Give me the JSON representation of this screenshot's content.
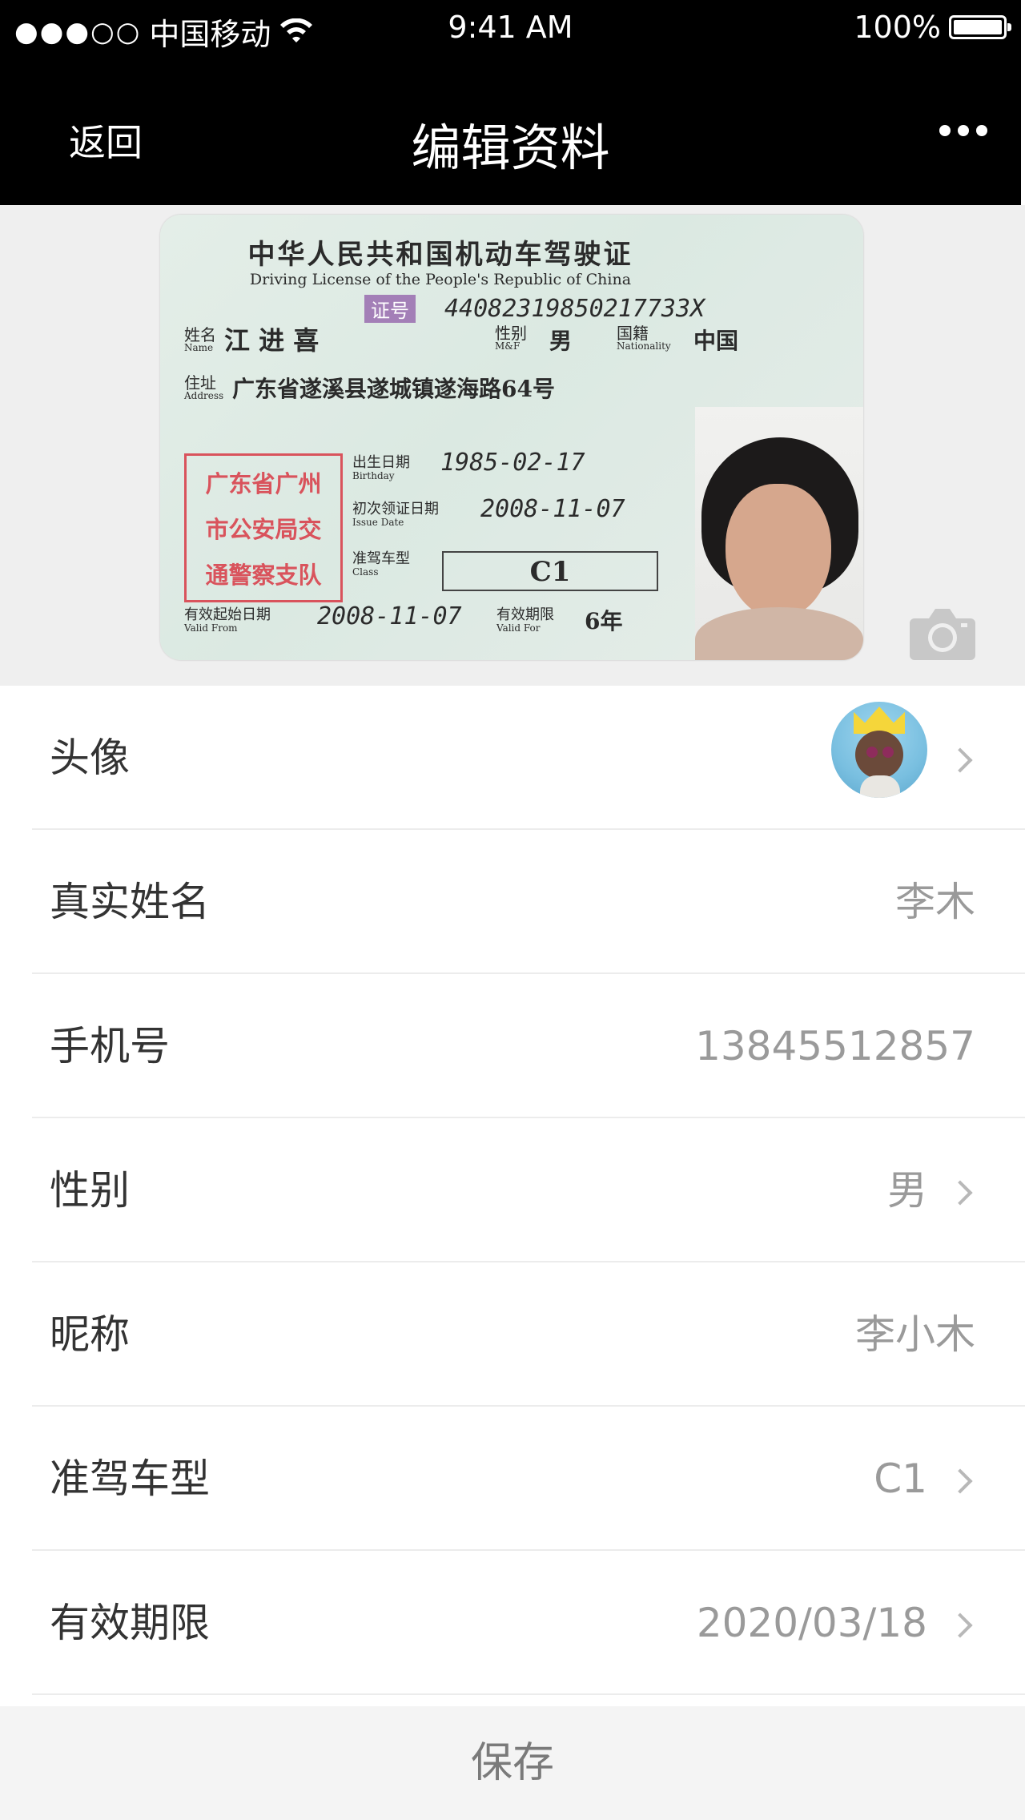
{
  "status_bar": {
    "signal": "●●●○○",
    "carrier": "中国移动",
    "time": "9:41 AM",
    "battery_text": "100%",
    "battery_level": 1.0
  },
  "nav": {
    "back_label": "返回",
    "title": "编辑资料",
    "more_icon": "more-icon"
  },
  "license": {
    "title": "中华人民共和国机动车驾驶证",
    "subtitle": "Driving License of the People's Republic of China",
    "cert_label": "证号",
    "cert_number": "44082319850217733X",
    "name_label": "姓名",
    "name_label_en": "Name",
    "name": "江 进 喜",
    "sex_label": "性别",
    "sex_label_en": "M&F",
    "sex": "男",
    "nationality_label": "国籍",
    "nationality_label_en": "Nationality",
    "nationality": "中国",
    "address_label": "住址",
    "address_label_en": "Address",
    "address": "广东省遂溪县遂城镇遂海路64号",
    "stamp_lines": [
      "广东省广州",
      "市公安局交",
      "通警察支队"
    ],
    "birthday_label": "出生日期",
    "birthday_label_en": "Birthday",
    "birthday": "1985-02-17",
    "issue_label": "初次领证日期",
    "issue_label_en": "Issue Date",
    "issue_date": "2008-11-07",
    "class_label": "准驾车型",
    "class_label_en": "Class",
    "class": "C1",
    "valid_from_label": "有效起始日期",
    "valid_from_label_en": "Valid From",
    "valid_from": "2008-11-07",
    "valid_for_label": "有效期限",
    "valid_for_label_en": "Valid For",
    "valid_for": "6年"
  },
  "rows": [
    {
      "label": "头像",
      "value": ""
    },
    {
      "label": "真实姓名",
      "value": "李木"
    },
    {
      "label": "手机号",
      "value": "13845512857"
    },
    {
      "label": "性别",
      "value": "男"
    },
    {
      "label": "昵称",
      "value": "李小木"
    },
    {
      "label": "准驾车型",
      "value": "C1"
    },
    {
      "label": "有效期限",
      "value": "2020/03/18"
    }
  ],
  "save_label": "保存"
}
